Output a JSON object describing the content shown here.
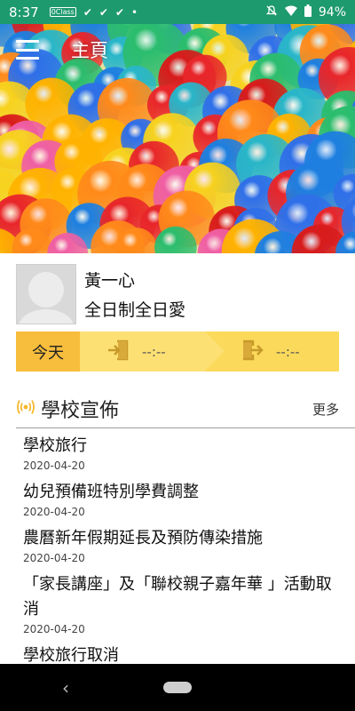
{
  "statusbar": {
    "time": "8:37",
    "icons_left": [
      "app-notification-icon",
      "check-icon",
      "check-icon",
      "check-icon",
      "dot-icon"
    ],
    "app_label": "0Class",
    "battery": "94%"
  },
  "header": {
    "title": "主頁",
    "menu_icon": "hamburger-menu-icon"
  },
  "profile": {
    "name": "黃一心",
    "class": "全日制全日愛"
  },
  "attendance": {
    "today_label": "今天",
    "check_in_time": "--:--",
    "check_out_time": "--:--"
  },
  "announcements": {
    "title": "學校宣佈",
    "more_label": "更多",
    "items": [
      {
        "title": "學校旅行",
        "date": "2020-04-20"
      },
      {
        "title": "幼兒預備班特別學費調整",
        "date": "2020-04-20"
      },
      {
        "title": "農曆新年假期延長及預防傳染措施",
        "date": "2020-04-20"
      },
      {
        "title": "「家長講座」及「聯校親子嘉年華 」活動取消",
        "date": "2020-04-20"
      },
      {
        "title": "學校旅行取消",
        "date": ""
      }
    ]
  },
  "colors": {
    "statusbar": "#1e9a6f",
    "attendance_today": "#f7bd3c",
    "attendance_bar": "#fbd95a",
    "accent_icon": "#f5b82e"
  }
}
